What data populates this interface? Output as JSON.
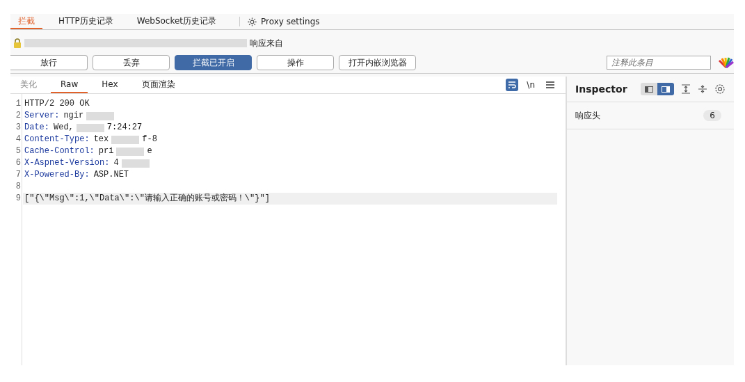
{
  "tabs": [
    {
      "label": "拦截",
      "selected": true
    },
    {
      "label": "HTTP历史记录",
      "selected": false
    },
    {
      "label": "WebSocket历史记录",
      "selected": false
    }
  ],
  "proxy_settings": {
    "label": "Proxy settings"
  },
  "request_info": {
    "text": "响应来自"
  },
  "buttons": [
    {
      "label": "放行",
      "selected": false
    },
    {
      "label": "丢弃",
      "selected": false
    },
    {
      "label": "拦截已开启",
      "selected": true
    },
    {
      "label": "操作",
      "selected": false
    },
    {
      "label": "打开内嵌浏览器",
      "selected": false
    }
  ],
  "comment_field": {
    "placeholder": "注释此条目"
  },
  "editor": {
    "tabs": [
      {
        "label": "美化",
        "selected": false,
        "disabled": true
      },
      {
        "label": "Raw",
        "selected": true,
        "disabled": false
      },
      {
        "label": "Hex",
        "selected": false,
        "disabled": false
      },
      {
        "label": "页面渲染",
        "selected": false,
        "disabled": false
      }
    ],
    "wrap_on": true,
    "newline_label": "\\n",
    "lines": [
      {
        "number": "1",
        "parts": [
          {
            "kind": "text",
            "text": "HTTP/2 200 OK"
          }
        ],
        "highlighted": false
      },
      {
        "number": "2",
        "key": "Server:",
        "parts": [
          {
            "kind": "text",
            "text": "ngir"
          },
          {
            "kind": "redacted"
          }
        ],
        "highlighted": false
      },
      {
        "number": "3",
        "key": "Date:",
        "parts": [
          {
            "kind": "text",
            "text": "Wed,"
          },
          {
            "kind": "redacted"
          },
          {
            "kind": "text",
            "text": "7:24:27"
          }
        ],
        "highlighted": false
      },
      {
        "number": "4",
        "key": "Content-Type:",
        "parts": [
          {
            "kind": "text",
            "text": "tex"
          },
          {
            "kind": "redacted"
          },
          {
            "kind": "text",
            "text": "f-8"
          }
        ],
        "highlighted": false
      },
      {
        "number": "5",
        "key": "Cache-Control:",
        "parts": [
          {
            "kind": "text",
            "text": "pri"
          },
          {
            "kind": "redacted"
          },
          {
            "kind": "text",
            "text": "e"
          }
        ],
        "highlighted": false
      },
      {
        "number": "6",
        "key": "X-Aspnet-Version:",
        "parts": [
          {
            "kind": "text",
            "text": "4"
          },
          {
            "kind": "redacted"
          }
        ],
        "highlighted": false
      },
      {
        "number": "7",
        "key": "X-Powered-By:",
        "parts": [
          {
            "kind": "text",
            "text": "ASP.NET"
          }
        ],
        "highlighted": false
      },
      {
        "number": "8",
        "highlighted": false
      },
      {
        "number": "9",
        "parts": [
          {
            "kind": "text",
            "text": "[\"{\\\"Msg\\\":1,\\\"Data\\\":\\\"请输入正确的账号或密码！\\\"}\"]"
          }
        ],
        "highlighted": true
      }
    ]
  },
  "inspector": {
    "title": "Inspector",
    "layout": [
      {
        "selected": false
      },
      {
        "selected": true
      }
    ],
    "sections": [
      {
        "label": "响应头",
        "count": "6"
      }
    ]
  }
}
